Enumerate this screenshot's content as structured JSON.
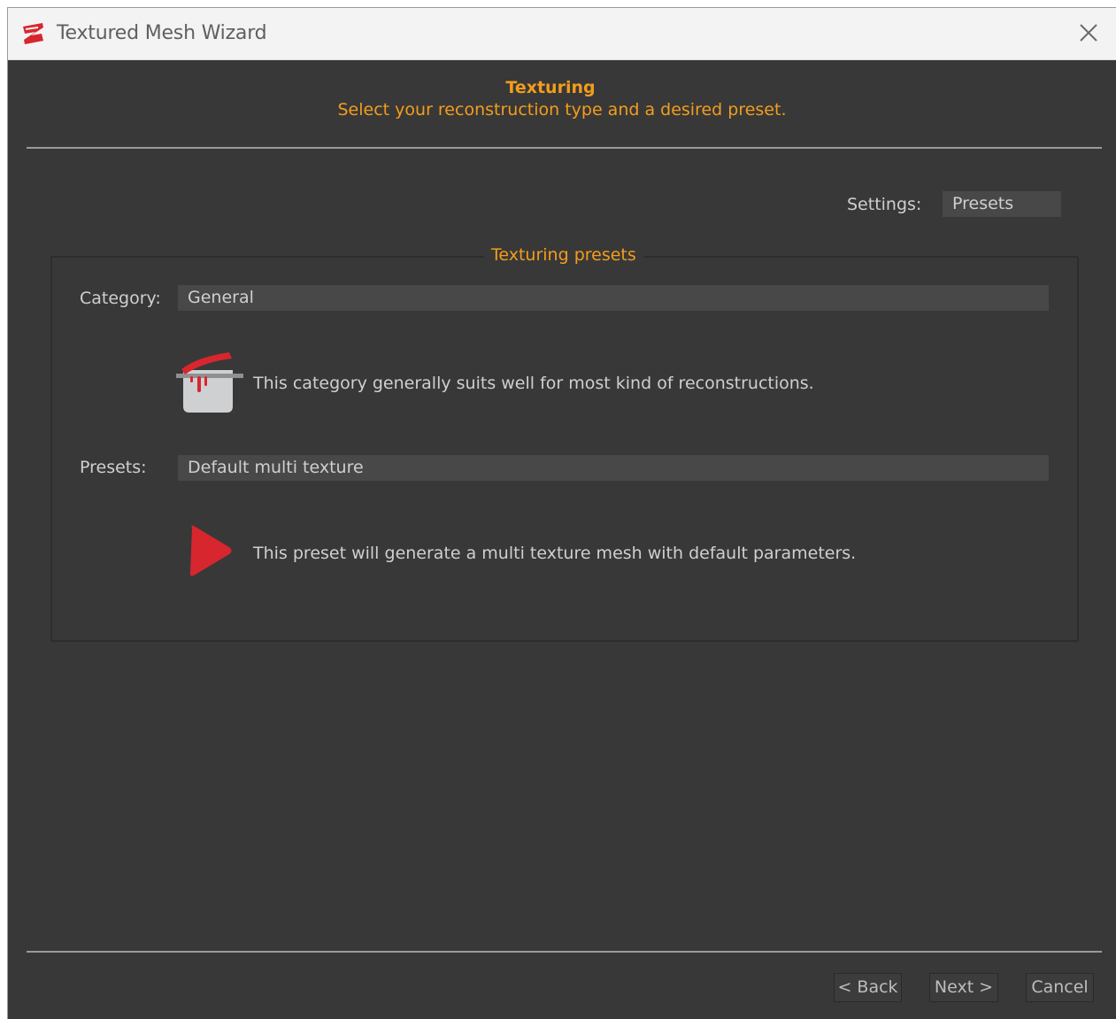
{
  "window": {
    "title": "Textured Mesh Wizard",
    "close_icon": "close-icon"
  },
  "header": {
    "title": "Texturing",
    "subtitle": "Select your reconstruction type and a desired preset."
  },
  "settings": {
    "label": "Settings:",
    "value": "Presets"
  },
  "group": {
    "title": "Texturing presets",
    "category": {
      "label": "Category:",
      "value": "General",
      "icon": "cooking-pot-icon",
      "description": "This category generally suits well for most kind of reconstructions."
    },
    "presets": {
      "label": "Presets:",
      "value": "Default multi texture",
      "icon": "play-icon",
      "description": "This preset will generate a multi texture mesh with default parameters."
    }
  },
  "footer": {
    "back_label": "< Back",
    "next_label": "Next >",
    "cancel_label": "Cancel"
  },
  "colors": {
    "accent": "#f39d1c",
    "background": "#383838",
    "brand_red": "#d8262e"
  }
}
